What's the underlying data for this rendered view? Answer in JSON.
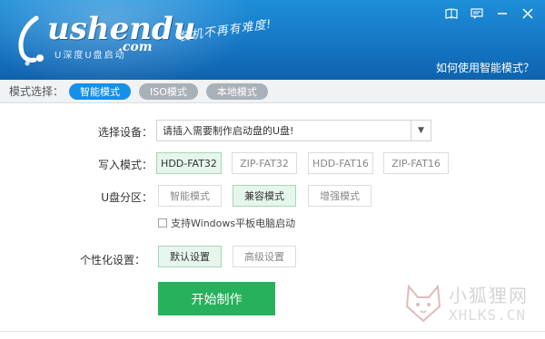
{
  "header": {
    "logo_text": "ushendu",
    "logo_sub": "U深度U盘启动",
    "logo_dotcom": ".com",
    "slogan": "装机不再有难度!",
    "help_link": "如何使用智能模式？",
    "window_buttons": [
      "book-icon",
      "feedback-icon",
      "minimize-icon",
      "close-icon"
    ]
  },
  "mode_bar": {
    "label": "模式选择：",
    "tabs": [
      {
        "label": "智能模式",
        "active": true
      },
      {
        "label": "ISO模式",
        "active": false
      },
      {
        "label": "本地模式",
        "active": false
      }
    ]
  },
  "device": {
    "label": "选择设备：",
    "value": "请插入需要制作启动盘的U盘!"
  },
  "write_mode": {
    "label": "写入模式：",
    "options": [
      "HDD-FAT32",
      "ZIP-FAT32",
      "HDD-FAT16",
      "ZIP-FAT16"
    ],
    "selected": "HDD-FAT32"
  },
  "partition": {
    "label": "U盘分区：",
    "options": [
      "智能模式",
      "兼容模式",
      "增强模式"
    ],
    "selected": "兼容模式"
  },
  "windows_tablet": {
    "label": "支持Windows平板电脑启动",
    "checked": false
  },
  "personalize": {
    "label": "个性化设置：",
    "options": [
      "默认设置",
      "高级设置"
    ],
    "selected": "默认设置"
  },
  "start_button": "开始制作",
  "watermark": {
    "cn": "小狐狸网",
    "en": "XHLKS.CN"
  },
  "colors": {
    "header_blue": "#1576c4",
    "tab_active": "#1590e8",
    "start_green": "#27b15c",
    "selected_bg": "#e6f6ec"
  }
}
